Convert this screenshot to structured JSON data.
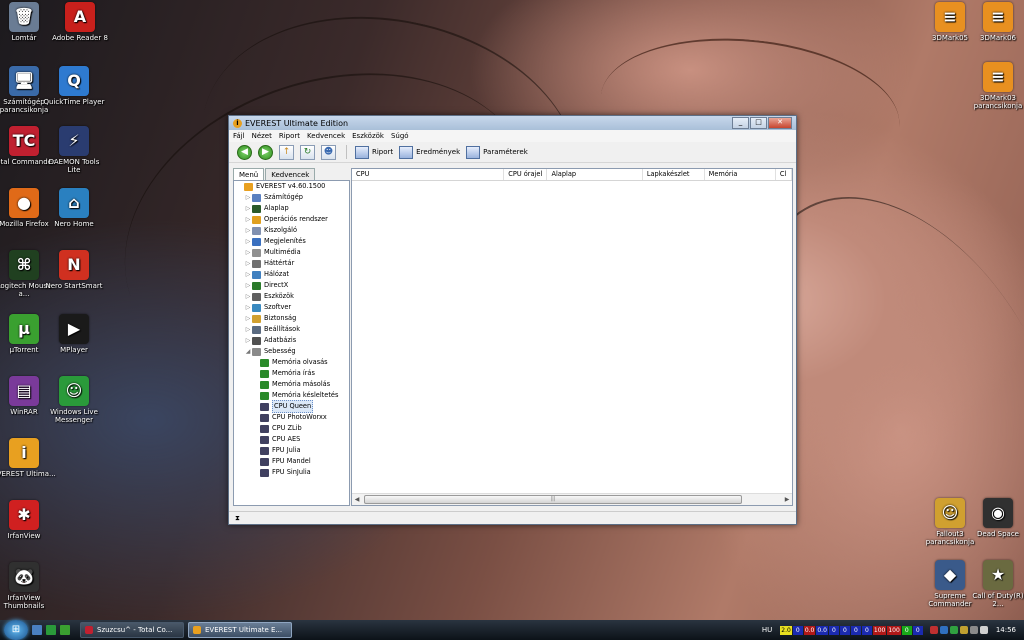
{
  "desktop": {
    "left_icons": [
      {
        "id": "lomtar",
        "label": "Lomtár",
        "glyph": "🗑",
        "color": "#6a7c94"
      },
      {
        "id": "adobe",
        "label": "Adobe Reader 8",
        "glyph": "A",
        "color": "#c8201c"
      },
      {
        "id": "szamitogep",
        "label": "Számítógép parancsikonja",
        "glyph": "🖥",
        "color": "#3a6aa8"
      },
      {
        "id": "quicktime",
        "label": "QuickTime Player",
        "glyph": "Q",
        "color": "#2e7ad0"
      },
      {
        "id": "totalcmd",
        "label": "Total Commander",
        "glyph": "TC",
        "color": "#c02030"
      },
      {
        "id": "daemon",
        "label": "DAEMON Tools Lite",
        "glyph": "⚡",
        "color": "#2a3c70"
      },
      {
        "id": "firefox",
        "label": "Mozilla Firefox",
        "glyph": "●",
        "color": "#e06a18"
      },
      {
        "id": "nerohome",
        "label": "Nero Home",
        "glyph": "⌂",
        "color": "#2a80c0"
      },
      {
        "id": "logitech",
        "label": "Logitech Mouse a...",
        "glyph": "⌘",
        "color": "#204020"
      },
      {
        "id": "nerostart",
        "label": "Nero StartSmart",
        "glyph": "N",
        "color": "#d03020"
      },
      {
        "id": "utorrent",
        "label": "µTorrent",
        "glyph": "µ",
        "color": "#3aa030"
      },
      {
        "id": "mplayer",
        "label": "MPlayer",
        "glyph": "▶",
        "color": "#1a1a1a"
      },
      {
        "id": "winrar",
        "label": "WinRAR",
        "glyph": "▤",
        "color": "#7a3a9a"
      },
      {
        "id": "messenger",
        "label": "Windows Live Messenger",
        "glyph": "☺",
        "color": "#2a9a3a"
      },
      {
        "id": "everest",
        "label": "EVEREST Ultima...",
        "glyph": "i",
        "color": "#e8a020"
      },
      {
        "id": "irfan",
        "label": "IrfanView",
        "glyph": "✱",
        "color": "#d02020"
      },
      {
        "id": "irfanthumbs",
        "label": "IrfanView Thumbnails",
        "glyph": "🐼",
        "color": "#303030"
      }
    ],
    "right_icons": [
      {
        "id": "3dmark05",
        "label": "3DMark05",
        "glyph": "≡",
        "color": "#e89020"
      },
      {
        "id": "3dmark06",
        "label": "3DMark06",
        "glyph": "≡",
        "color": "#e89020"
      },
      {
        "id": "3dmark03",
        "label": "3DMark03 parancsikonja",
        "glyph": "≡",
        "color": "#e89020"
      },
      {
        "id": "fallout",
        "label": "Fallout3 parancsikonja",
        "glyph": "☺",
        "color": "#d0a030"
      },
      {
        "id": "deadspace",
        "label": "Dead Space",
        "glyph": "◉",
        "color": "#303030"
      },
      {
        "id": "supcom",
        "label": "Supreme Commander",
        "glyph": "◆",
        "color": "#3a5a8a"
      },
      {
        "id": "cod",
        "label": "Call of Duty(R) 2...",
        "glyph": "★",
        "color": "#6a6a40"
      }
    ]
  },
  "window": {
    "title": "EVEREST Ultimate Edition",
    "menu": [
      "Fájl",
      "Nézet",
      "Riport",
      "Kedvencek",
      "Eszközök",
      "Súgó"
    ],
    "toolbar": {
      "report": "Riport",
      "results": "Eredmények",
      "params": "Paraméterek"
    },
    "tabs": [
      "Menü",
      "Kedvencek"
    ],
    "tree": [
      {
        "label": "EVEREST v4.60.1500",
        "level": 0,
        "exp": "",
        "color": "#e8a020"
      },
      {
        "label": "Számítógép",
        "level": 1,
        "exp": "▷",
        "color": "#5a80c0"
      },
      {
        "label": "Alaplap",
        "level": 1,
        "exp": "▷",
        "color": "#2a5a2a"
      },
      {
        "label": "Operációs rendszer",
        "level": 1,
        "exp": "▷",
        "color": "#e0a020"
      },
      {
        "label": "Kiszolgáló",
        "level": 1,
        "exp": "▷",
        "color": "#8090b0"
      },
      {
        "label": "Megjelenítés",
        "level": 1,
        "exp": "▷",
        "color": "#3a70c0"
      },
      {
        "label": "Multimédia",
        "level": 1,
        "exp": "▷",
        "color": "#909090"
      },
      {
        "label": "Háttértár",
        "level": 1,
        "exp": "▷",
        "color": "#707070"
      },
      {
        "label": "Hálózat",
        "level": 1,
        "exp": "▷",
        "color": "#4080c0"
      },
      {
        "label": "DirectX",
        "level": 1,
        "exp": "▷",
        "color": "#2a7a2a"
      },
      {
        "label": "Eszközök",
        "level": 1,
        "exp": "▷",
        "color": "#606060"
      },
      {
        "label": "Szoftver",
        "level": 1,
        "exp": "▷",
        "color": "#3a8ac0"
      },
      {
        "label": "Biztonság",
        "level": 1,
        "exp": "▷",
        "color": "#d0a030"
      },
      {
        "label": "Beállítások",
        "level": 1,
        "exp": "▷",
        "color": "#5a6a80"
      },
      {
        "label": "Adatbázis",
        "level": 1,
        "exp": "▷",
        "color": "#505050"
      },
      {
        "label": "Sebesség",
        "level": 1,
        "exp": "◢",
        "color": "#8a8a8a"
      },
      {
        "label": "Memória olvasás",
        "level": 2,
        "exp": "",
        "color": "#2a8a2a"
      },
      {
        "label": "Memória írás",
        "level": 2,
        "exp": "",
        "color": "#2a8a2a"
      },
      {
        "label": "Memória másolás",
        "level": 2,
        "exp": "",
        "color": "#2a8a2a"
      },
      {
        "label": "Memória késleltetés",
        "level": 2,
        "exp": "",
        "color": "#2a8a2a"
      },
      {
        "label": "CPU Queen",
        "level": 2,
        "exp": "",
        "color": "#404060",
        "selected": true
      },
      {
        "label": "CPU PhotoWorxx",
        "level": 2,
        "exp": "",
        "color": "#404060"
      },
      {
        "label": "CPU ZLib",
        "level": 2,
        "exp": "",
        "color": "#404060"
      },
      {
        "label": "CPU AES",
        "level": 2,
        "exp": "",
        "color": "#404060"
      },
      {
        "label": "FPU Julia",
        "level": 2,
        "exp": "",
        "color": "#404060"
      },
      {
        "label": "FPU Mandel",
        "level": 2,
        "exp": "",
        "color": "#404060"
      },
      {
        "label": "FPU SinJulia",
        "level": 2,
        "exp": "",
        "color": "#404060"
      }
    ],
    "columns": [
      {
        "label": "CPU"
      },
      {
        "label": "CPU órajel"
      },
      {
        "label": "Alaplap"
      },
      {
        "label": "Lapkakészlet"
      },
      {
        "label": "Memória"
      },
      {
        "label": "Cl"
      }
    ],
    "hscroll_grip": "|||",
    "status_icon": "⧗"
  },
  "taskbar": {
    "tasks": [
      {
        "label": "Szuzcsu^ - Total Co...",
        "color": "#c02030",
        "active": false
      },
      {
        "label": "EVEREST Ultimate E...",
        "color": "#e8a020",
        "active": true
      }
    ],
    "lang": "HU",
    "meter": [
      {
        "t": "2.0",
        "c": "y"
      },
      {
        "t": "0",
        "c": ""
      },
      {
        "t": "0.0",
        "c": "r"
      },
      {
        "t": "0.0",
        "c": ""
      },
      {
        "t": "0",
        "c": ""
      },
      {
        "t": "0",
        "c": ""
      },
      {
        "t": "0",
        "c": ""
      },
      {
        "t": "0",
        "c": ""
      },
      {
        "t": "100",
        "c": "r"
      },
      {
        "t": "100",
        "c": "r"
      },
      {
        "t": "0",
        "c": "g"
      },
      {
        "t": "0",
        "c": ""
      }
    ],
    "clock": "14:56"
  }
}
